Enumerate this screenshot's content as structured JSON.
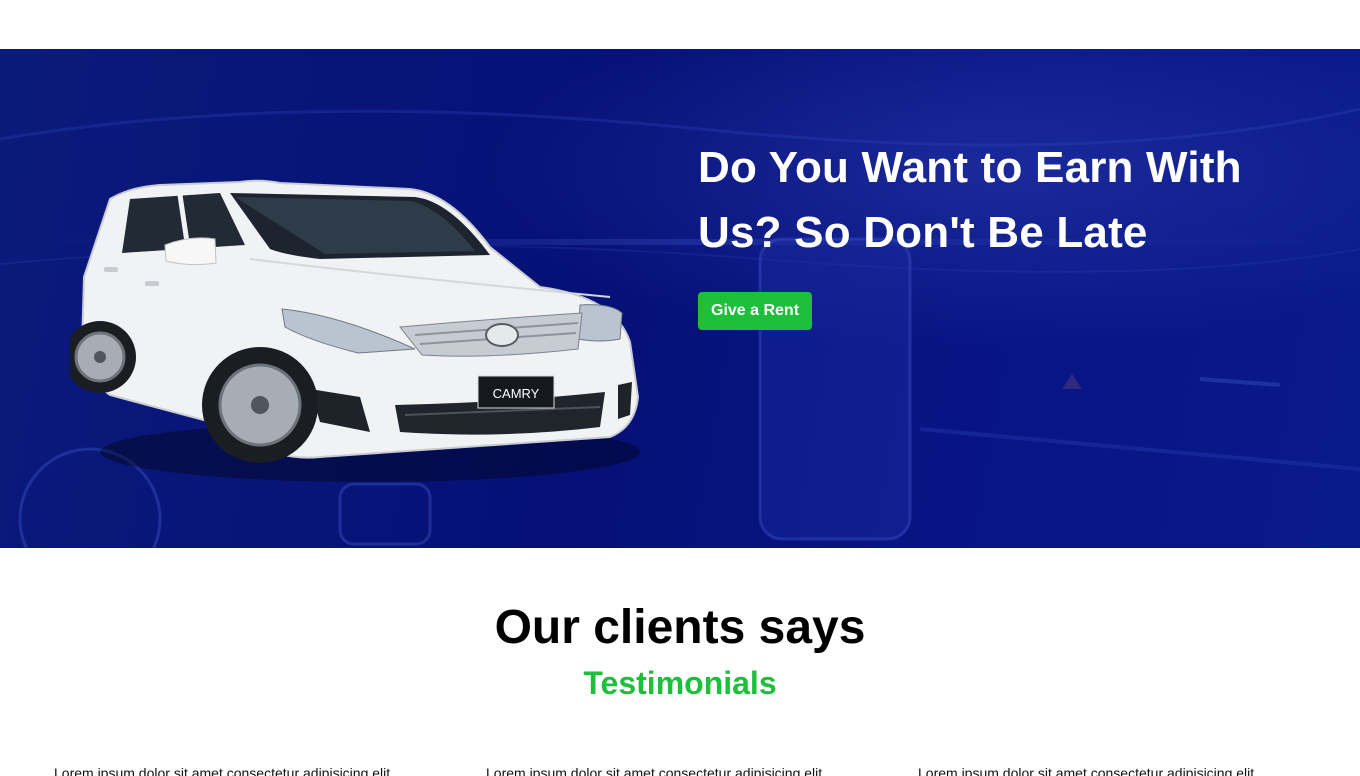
{
  "hero": {
    "title_line1": "Do You Want to Earn With",
    "title_line2": "Us? So Don't Be Late",
    "cta_label": "Give a Rent",
    "car_plate": "CAMRY",
    "colors": {
      "background": "#061077",
      "cta": "#1dbf3b",
      "title": "#ffffff"
    }
  },
  "testimonials": {
    "title": "Our clients says",
    "subtitle": "Testimonials",
    "subtitle_color": "#1dbf3b",
    "cards": [
      {
        "text": "Lorem ipsum dolor sit amet consectetur adipisicing elit"
      },
      {
        "text": "Lorem ipsum dolor sit amet consectetur adipisicing elit"
      },
      {
        "text": "Lorem ipsum dolor sit amet consectetur adipisicing elit"
      }
    ]
  }
}
